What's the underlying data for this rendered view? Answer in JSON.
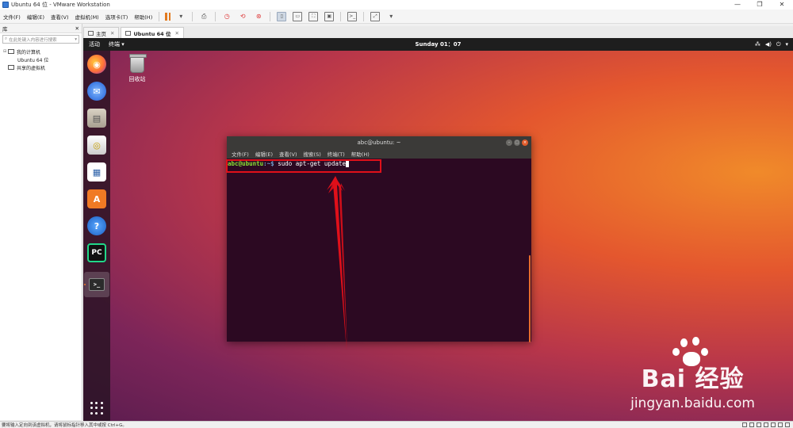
{
  "window": {
    "title": "Ubuntu 64 位 - VMware Workstation",
    "controls": [
      "—",
      "❐",
      "✕"
    ]
  },
  "menubar": {
    "items": [
      "文件(F)",
      "编辑(E)",
      "查看(V)",
      "虚拟机(M)",
      "选项卡(T)",
      "帮助(H)"
    ]
  },
  "library": {
    "title": "库",
    "close": "✕",
    "search_placeholder": "在此处键入内容进行搜索",
    "tree": {
      "my_computer": "我的计算机",
      "vm": "Ubuntu 64 位",
      "shared": "共享的虚拟机"
    }
  },
  "tabs": [
    {
      "label": "主页",
      "close": "✕"
    },
    {
      "label": "Ubuntu 64 位",
      "close": "✕"
    }
  ],
  "ubuntu": {
    "topbar": {
      "activities": "活动",
      "app_menu": "终端 ▾",
      "clock": "Sunday 01：07",
      "sys_icons": [
        "network-icon",
        "volume-icon",
        "power-icon"
      ]
    },
    "desktop": {
      "trash_label": "回收站"
    },
    "dock": [
      "firefox-icon",
      "thunderbird-icon",
      "files-icon",
      "rhythmbox-icon",
      "libreoffice-writer-icon",
      "software-center-icon",
      "help-icon",
      "pycharm-icon",
      "terminal-icon"
    ],
    "terminal": {
      "title": "abc@ubuntu: ~",
      "menu": [
        "文件(F)",
        "编辑(E)",
        "查看(V)",
        "搜索(S)",
        "终端(T)",
        "帮助(H)"
      ],
      "prompt_user": "abc@ubuntu",
      "prompt_path": ":~$",
      "command": " sudo apt-get update"
    }
  },
  "watermark": {
    "brand": "Bai 经验",
    "site": "jingyan.baidu.com"
  },
  "statusbar": {
    "text": "要将输入定向到该虚拟机，请将鼠标指针移入其中或按 Ctrl+G。"
  },
  "colors": {
    "accent": "#e27a1f",
    "highlight": "#e0101a",
    "prompt_user": "#8ae234",
    "prompt_path": "#729fcf"
  }
}
